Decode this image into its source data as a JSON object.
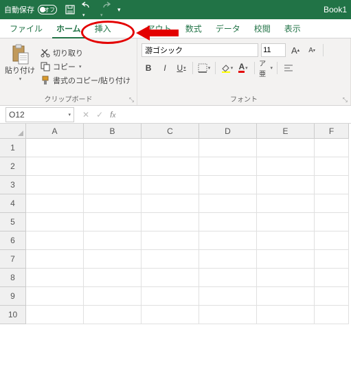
{
  "titlebar": {
    "autosave_label": "自動保存",
    "autosave_state": "オフ",
    "book_title": "Book1"
  },
  "tabs": {
    "file": "ファイル",
    "home": "ホーム",
    "insert": "挿入",
    "layout": "アウト",
    "formulas": "数式",
    "data": "データ",
    "review": "校閲",
    "view": "表示"
  },
  "ribbon": {
    "clipboard": {
      "paste_label": "貼り付け",
      "cut_label": "切り取り",
      "copy_label": "コピー",
      "format_painter_label": "書式のコピー/貼り付け",
      "group_label": "クリップボード"
    },
    "font": {
      "name": "游ゴシック",
      "size": "11",
      "bold": "B",
      "italic": "I",
      "underline": "U",
      "ruby": "ア亜",
      "group_label": "フォント"
    }
  },
  "namebox": {
    "ref": "O12"
  },
  "grid": {
    "cols": [
      "A",
      "B",
      "C",
      "D",
      "E",
      "F"
    ],
    "rows": [
      "1",
      "2",
      "3",
      "4",
      "5",
      "6",
      "7",
      "8",
      "9",
      "10"
    ]
  }
}
